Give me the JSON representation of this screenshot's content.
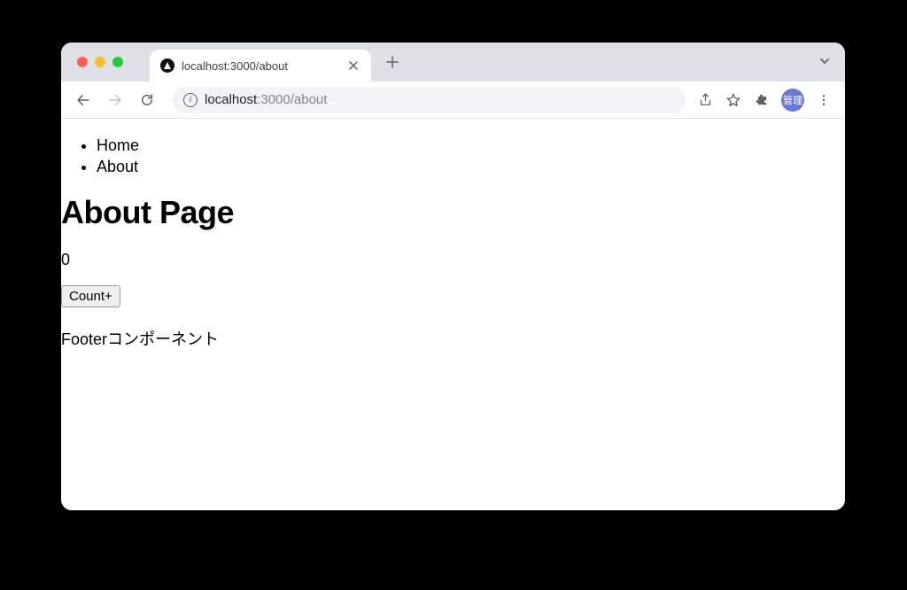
{
  "browser": {
    "tab_title": "localhost:3000/about",
    "url_host": "localhost",
    "url_path": ":3000/about",
    "profile_label": "管理"
  },
  "nav": {
    "items": [
      "Home",
      "About"
    ]
  },
  "page": {
    "heading": "About Page",
    "counter_value": "0",
    "counter_button": "Count+",
    "footer_text": "Footerコンポーネント"
  }
}
